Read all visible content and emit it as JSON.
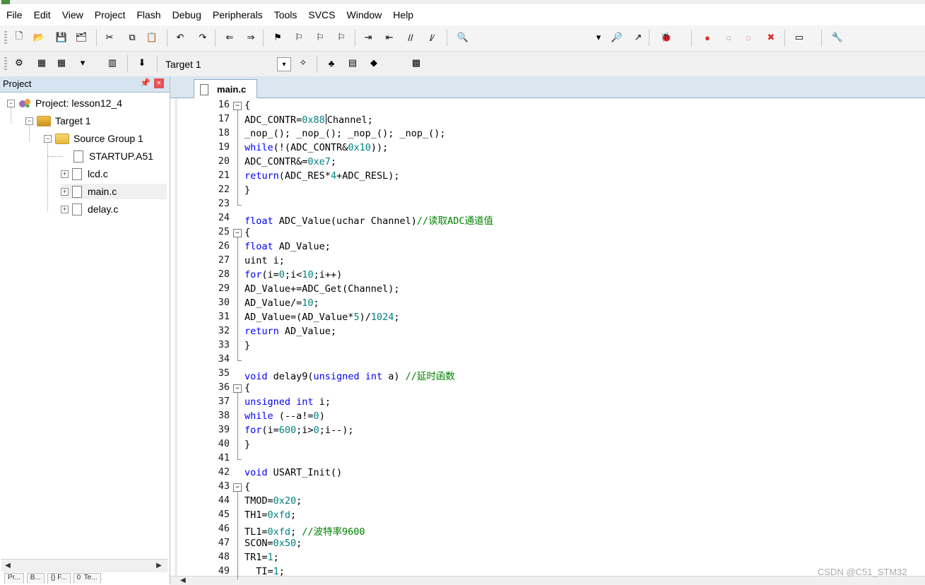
{
  "menu": [
    "File",
    "Edit",
    "View",
    "Project",
    "Flash",
    "Debug",
    "Peripherals",
    "Tools",
    "SVCS",
    "Window",
    "Help"
  ],
  "toolbar1_icons": [
    "new-file-icon",
    "open-file-icon",
    "save-icon",
    "save-all-icon",
    "cut-icon",
    "copy-icon",
    "paste-icon",
    "undo-icon",
    "redo-icon",
    "nav-back-icon",
    "nav-forward-icon",
    "bookmark-icon",
    "prev-bookmark-icon",
    "next-bookmark-icon",
    "clear-bookmarks-icon",
    "indent-icon",
    "unindent-icon",
    "comment-icon",
    "uncomment-icon",
    "find-in-files-icon",
    "dropdown-icon",
    "find-icon",
    "incremental-find-icon",
    "debug-session-icon",
    "breakpoint-icon",
    "disable-breakpoint-icon",
    "disable-all-breakpoints-icon",
    "kill-breakpoints-icon",
    "window-layout-icon",
    "configure-icon"
  ],
  "toolbar2": {
    "icons": [
      "translate-icon",
      "build-icon",
      "rebuild-icon",
      "batch-build-icon",
      "stop-build-icon",
      "download-icon",
      "target-options-icon",
      "manage-components-icon",
      "file-extensions-icon",
      "select-packs-icon",
      "pack-installer-icon"
    ],
    "target": "Target 1"
  },
  "project_panel": {
    "title": "Project",
    "tree": {
      "project": "Project: lesson12_4",
      "target": "Target 1",
      "group": "Source Group 1",
      "files": [
        "STARTUP.A51",
        "lcd.c",
        "main.c",
        "delay.c"
      ]
    },
    "bottom_tabs": [
      "Pr...",
      "B...",
      "{} F...",
      "0  Te..."
    ]
  },
  "editor": {
    "tab": "main.c",
    "lines": [
      {
        "n": "16",
        "code": "{"
      },
      {
        "n": "17",
        "code": "ADC_CONTR=0x88|Channel;"
      },
      {
        "n": "18",
        "code": "_nop_(); _nop_(); _nop_(); _nop_();"
      },
      {
        "n": "19",
        "code": "while(!(ADC_CONTR&0x10));"
      },
      {
        "n": "20",
        "code": "ADC_CONTR&=0xe7;"
      },
      {
        "n": "21",
        "code": "return(ADC_RES*4+ADC_RESL);"
      },
      {
        "n": "22",
        "code": "}"
      },
      {
        "n": "23",
        "code": ""
      },
      {
        "n": "24",
        "code": "float ADC_Value(uchar Channel)//读取ADC通道值"
      },
      {
        "n": "25",
        "code": "{"
      },
      {
        "n": "26",
        "code": "float AD_Value;"
      },
      {
        "n": "27",
        "code": "uint i;"
      },
      {
        "n": "28",
        "code": "for(i=0;i<10;i++)"
      },
      {
        "n": "29",
        "code": "AD_Value+=ADC_Get(Channel);"
      },
      {
        "n": "30",
        "code": "AD_Value/=10;"
      },
      {
        "n": "31",
        "code": "AD_Value=(AD_Value*5)/1024;"
      },
      {
        "n": "32",
        "code": "return AD_Value;"
      },
      {
        "n": "33",
        "code": "}"
      },
      {
        "n": "34",
        "code": ""
      },
      {
        "n": "35",
        "code": "void delay9(unsigned int a) //延时函数"
      },
      {
        "n": "36",
        "code": "{"
      },
      {
        "n": "37",
        "code": "unsigned int i;"
      },
      {
        "n": "38",
        "code": "while (--a!=0)"
      },
      {
        "n": "39",
        "code": "for(i=600;i>0;i--);"
      },
      {
        "n": "40",
        "code": "}"
      },
      {
        "n": "41",
        "code": ""
      },
      {
        "n": "42",
        "code": "void USART_Init()"
      },
      {
        "n": "43",
        "code": "{"
      },
      {
        "n": "44",
        "code": "TMOD=0x20;"
      },
      {
        "n": "45",
        "code": "TH1=0xfd;"
      },
      {
        "n": "46",
        "code": "TL1=0xfd; //波特率9600"
      },
      {
        "n": "47",
        "code": "SCON=0x50;"
      },
      {
        "n": "48",
        "code": "TR1=1;"
      },
      {
        "n": "49",
        "code": "  TI=1;"
      }
    ]
  },
  "watermark": "CSDN @C51_STM32",
  "colors": {
    "keyword": "#0000ff",
    "number": "#008080",
    "comment": "#008000",
    "panel_header": "#d7e4f2"
  }
}
